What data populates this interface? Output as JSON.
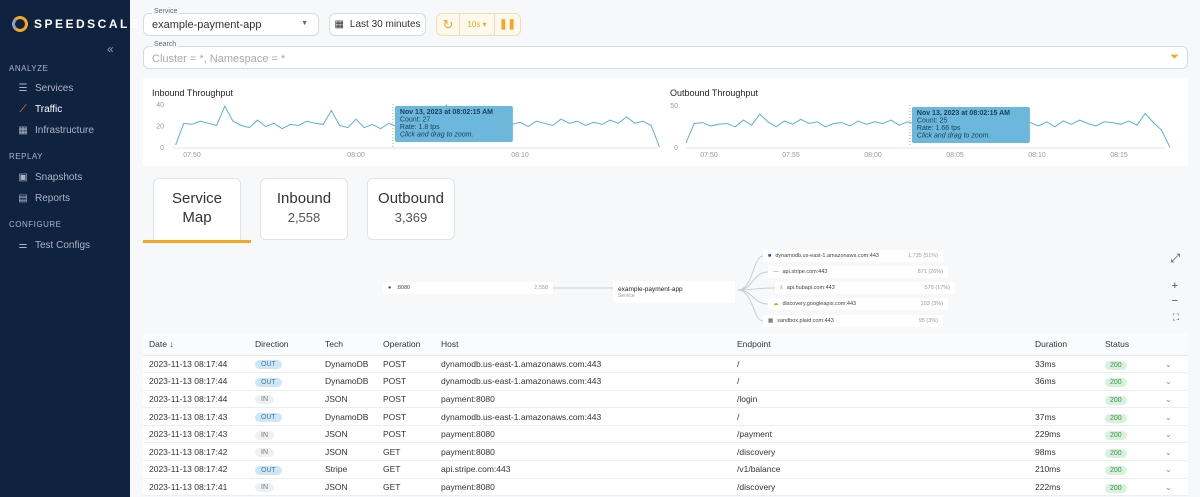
{
  "sidebar": {
    "brand": "SPEEDSCALE",
    "collapse": "«",
    "sections": [
      {
        "label": "ANALYZE",
        "items": [
          {
            "label": "Services",
            "icon": "list-icon"
          },
          {
            "label": "Traffic",
            "icon": "trend-icon",
            "active": true
          },
          {
            "label": "Infrastructure",
            "icon": "infra-icon"
          }
        ]
      },
      {
        "label": "REPLAY",
        "items": [
          {
            "label": "Snapshots",
            "icon": "snapshot-icon"
          },
          {
            "label": "Reports",
            "icon": "report-icon"
          }
        ]
      },
      {
        "label": "CONFIGURE",
        "items": [
          {
            "label": "Test Configs",
            "icon": "sliders-icon"
          }
        ]
      }
    ]
  },
  "toolbar": {
    "service_label": "Service",
    "service_value": "example-payment-app",
    "time_range": "Last 30 minutes",
    "refresh_interval": "10s",
    "search_label": "Search",
    "search_placeholder": "Cluster = *, Namespace = *"
  },
  "accent": "#f5a623",
  "chart_data": [
    {
      "type": "line",
      "title": "Inbound Throughput",
      "ylim": [
        0,
        40
      ],
      "yticks": [
        "0",
        "20",
        "40"
      ],
      "xticks": [
        "07:50",
        "08:00",
        "08:10"
      ],
      "x_start_min": -11,
      "x_step_min": 0.5,
      "values": [
        2,
        22,
        21,
        24,
        22,
        20,
        38,
        24,
        20,
        18,
        25,
        19,
        22,
        17,
        21,
        20,
        24,
        22,
        21,
        34,
        20,
        18,
        26,
        18,
        21,
        17,
        22,
        19,
        26,
        21,
        20,
        25,
        18,
        39,
        20,
        22,
        26,
        24,
        22,
        20,
        25,
        21,
        23,
        19,
        24,
        22,
        20,
        26,
        22,
        24,
        20,
        23,
        21,
        25,
        22,
        28,
        22,
        24,
        20,
        0
      ],
      "tooltip": {
        "title": "Nov 13, 2023 at 08:02:15 AM",
        "count": "Count: 27",
        "rate": "Rate: 1.8 tps",
        "hint": "Click and drag to zoom."
      }
    },
    {
      "type": "line",
      "title": "Outbound Throughput",
      "ylim": [
        0,
        50
      ],
      "yticks": [
        "0",
        "50"
      ],
      "xticks": [
        "07:50",
        "07:55",
        "08:00",
        "08:05",
        "08:10",
        "08:15"
      ],
      "x_start_min": -11.4,
      "x_step_min": 0.5,
      "values": [
        5,
        28,
        29,
        25,
        27,
        28,
        24,
        32,
        26,
        39,
        30,
        24,
        31,
        27,
        33,
        28,
        30,
        24,
        28,
        29,
        25,
        31,
        27,
        30,
        28,
        32,
        26,
        30,
        27,
        24,
        29,
        28,
        26,
        41,
        30,
        27,
        24,
        30,
        28,
        26,
        31,
        27,
        29,
        25,
        30,
        24,
        31,
        27,
        32,
        28,
        25,
        30,
        29,
        27,
        31,
        26,
        40,
        29,
        20,
        0
      ],
      "tooltip": {
        "title": "Nov 13, 2023 at 08:02:15 AM",
        "count": "Count: 25",
        "rate": "Rate: 1.66 tps",
        "hint": "Click and drag to zoom."
      }
    }
  ],
  "tabs": [
    {
      "label": "Service Map",
      "active": true
    },
    {
      "label": "Inbound",
      "value": "2,558"
    },
    {
      "label": "Outbound",
      "value": "3,369"
    }
  ],
  "map": {
    "source": {
      "label": ":8080",
      "count": "2,558"
    },
    "service": {
      "label": "example-payment-app",
      "sub": "Service"
    },
    "targets": [
      {
        "label": "dynamodb.us-east-1.amazonaws.com:443",
        "count": "1,735 (51%)"
      },
      {
        "label": "api.stripe.com:443",
        "count": "871 (26%)"
      },
      {
        "label": "api.hubapi.com:443",
        "count": "575 (17%)"
      },
      {
        "label": "discovery.googleapis.com:443",
        "count": "103 (3%)"
      },
      {
        "label": "sandbox.plaid.com:443",
        "count": "95 (3%)"
      }
    ]
  },
  "table": {
    "headers": [
      "Date ↓",
      "Direction",
      "Tech",
      "Operation",
      "Host",
      "Endpoint",
      "Duration",
      "Status"
    ],
    "rows": [
      [
        "2023-11-13 08:17:44",
        "OUT",
        "DynamoDB",
        "POST",
        "dynamodb.us-east-1.amazonaws.com:443",
        "/",
        "33ms",
        "200"
      ],
      [
        "2023-11-13 08:17:44",
        "OUT",
        "DynamoDB",
        "POST",
        "dynamodb.us-east-1.amazonaws.com:443",
        "/",
        "36ms",
        "200"
      ],
      [
        "2023-11-13 08:17:44",
        "IN",
        "JSON",
        "POST",
        "payment:8080",
        "/login",
        "",
        "200"
      ],
      [
        "2023-11-13 08:17:43",
        "OUT",
        "DynamoDB",
        "POST",
        "dynamodb.us-east-1.amazonaws.com:443",
        "/",
        "37ms",
        "200"
      ],
      [
        "2023-11-13 08:17:43",
        "IN",
        "JSON",
        "POST",
        "payment:8080",
        "/payment",
        "229ms",
        "200"
      ],
      [
        "2023-11-13 08:17:42",
        "IN",
        "JSON",
        "GET",
        "payment:8080",
        "/discovery",
        "98ms",
        "200"
      ],
      [
        "2023-11-13 08:17:42",
        "OUT",
        "Stripe",
        "GET",
        "api.stripe.com:443",
        "/v1/balance",
        "210ms",
        "200"
      ],
      [
        "2023-11-13 08:17:41",
        "IN",
        "JSON",
        "GET",
        "payment:8080",
        "/discovery",
        "222ms",
        "200"
      ]
    ]
  }
}
